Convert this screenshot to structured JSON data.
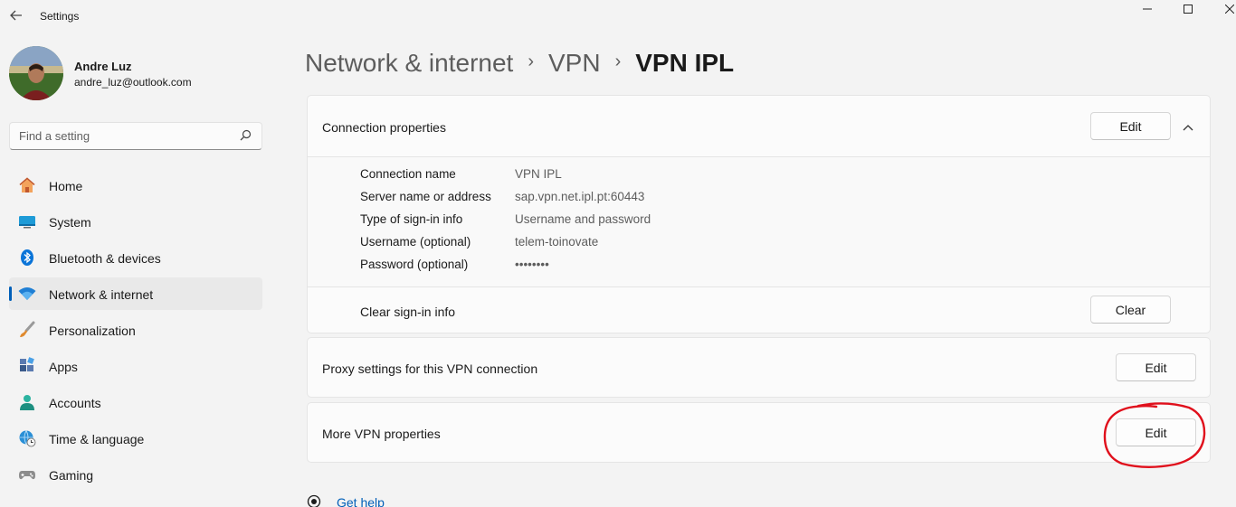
{
  "window": {
    "title": "Settings",
    "back_icon": "back-arrow-icon",
    "minimize_glyph": "—",
    "maximize_glyph": "□",
    "close_glyph": "✕"
  },
  "profile": {
    "name": "Andre Luz",
    "email": "andre_luz@outlook.com"
  },
  "search": {
    "placeholder": "Find a setting",
    "value": ""
  },
  "sidebar": {
    "items": [
      {
        "label": "Home",
        "icon": "home-icon",
        "active": false
      },
      {
        "label": "System",
        "icon": "system-icon",
        "active": false
      },
      {
        "label": "Bluetooth & devices",
        "icon": "bluetooth-icon",
        "active": false
      },
      {
        "label": "Network & internet",
        "icon": "wifi-icon",
        "active": true
      },
      {
        "label": "Personalization",
        "icon": "brush-icon",
        "active": false
      },
      {
        "label": "Apps",
        "icon": "apps-icon",
        "active": false
      },
      {
        "label": "Accounts",
        "icon": "accounts-icon",
        "active": false
      },
      {
        "label": "Time & language",
        "icon": "globe-clock-icon",
        "active": false
      },
      {
        "label": "Gaming",
        "icon": "gamepad-icon",
        "active": false
      }
    ]
  },
  "breadcrumb": {
    "items": [
      "Network & internet",
      "VPN",
      "VPN IPL"
    ],
    "separator": "›"
  },
  "connection_properties": {
    "title": "Connection properties",
    "edit_label": "Edit",
    "expanded": true,
    "fields": [
      {
        "label": "Connection name",
        "value": "VPN IPL"
      },
      {
        "label": "Server name or address",
        "value": "sap.vpn.net.ipl.pt:60443"
      },
      {
        "label": "Type of sign-in info",
        "value": "Username and password"
      },
      {
        "label": "Username (optional)",
        "value": "telem-toinovate"
      },
      {
        "label": "Password (optional)",
        "value": "••••••••"
      }
    ],
    "clear_row_label": "Clear sign-in info",
    "clear_button_label": "Clear"
  },
  "proxy": {
    "title": "Proxy settings for this VPN connection",
    "edit_label": "Edit"
  },
  "more_vpn": {
    "title": "More VPN properties",
    "edit_label": "Edit",
    "annotation_color": "#e0101c"
  },
  "help": {
    "label": "Get help"
  },
  "colors": {
    "accent": "#005fb8",
    "background": "#f3f3f3",
    "card": "#fbfbfb"
  }
}
